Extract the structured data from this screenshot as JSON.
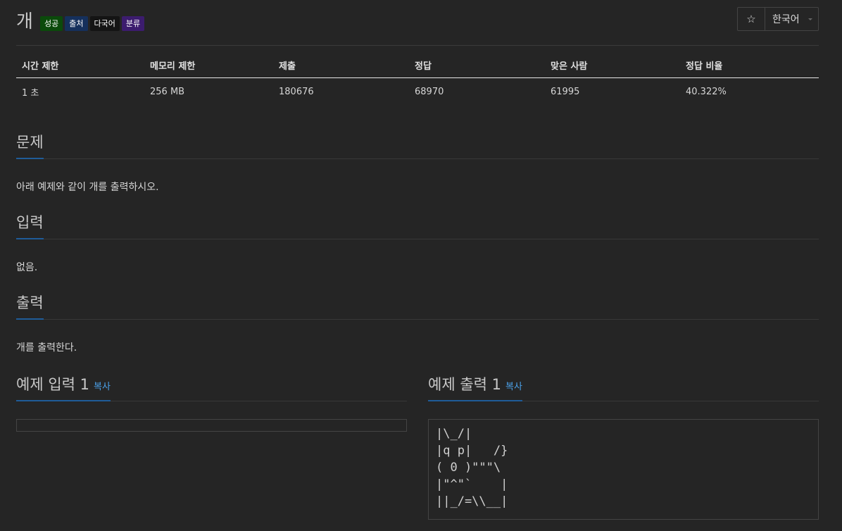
{
  "problem": {
    "title": "개",
    "badges": [
      "성공",
      "출처",
      "다국어",
      "분류"
    ]
  },
  "header_buttons": {
    "star_icon": "☆",
    "language": "한국어"
  },
  "stats": {
    "headers": [
      "시간 제한",
      "메모리 제한",
      "제출",
      "정답",
      "맞은 사람",
      "정답 비율"
    ],
    "values": [
      "1 초",
      "256 MB",
      "180676",
      "68970",
      "61995",
      "40.322%"
    ]
  },
  "sections": {
    "problem": {
      "title": "문제",
      "body": "아래 예제와 같이 개를 출력하시오."
    },
    "input": {
      "title": "입력",
      "body": "없음."
    },
    "output": {
      "title": "출력",
      "body": "개를 출력한다."
    }
  },
  "samples": {
    "input": {
      "title": "예제 입력 1",
      "copy_label": "복사",
      "content": ""
    },
    "output": {
      "title": "예제 출력 1",
      "copy_label": "복사",
      "content": "|\\_/|\n|q p|   /}\n( 0 )\"\"\"\\\n|\"^\"`    |\n||_/=\\\\__|"
    }
  },
  "colors": {
    "background": "#252525",
    "accent": "#1f5c99",
    "link": "#4aa0e8",
    "badge_success": "#0b4a0b",
    "badge_source": "#15305c",
    "badge_multilang": "#141414",
    "badge_class": "#3c1c6e"
  }
}
